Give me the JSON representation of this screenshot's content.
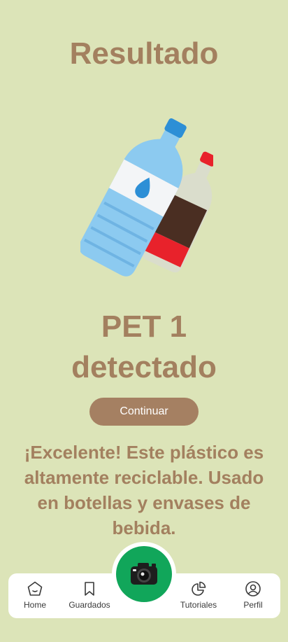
{
  "title": "Resultado",
  "result": {
    "line1": "PET 1",
    "line2": "detectado"
  },
  "continue_label": "Continuar",
  "message": "¡Excelente! Este plástico es altamente reciclable. Usado en botellas y envases de bebida.",
  "nav": {
    "items": [
      {
        "label": "Home",
        "icon": "home-icon"
      },
      {
        "label": "Guardados",
        "icon": "bookmark-icon"
      },
      {
        "label": "Tutoriales",
        "icon": "pie-chart-icon"
      },
      {
        "label": "Perfil",
        "icon": "profile-icon"
      }
    ],
    "center_icon": "camera-icon"
  },
  "colors": {
    "background": "#dce4b8",
    "accent_text": "#a3805f",
    "button": "#a58062",
    "camera": "#11a65a"
  }
}
